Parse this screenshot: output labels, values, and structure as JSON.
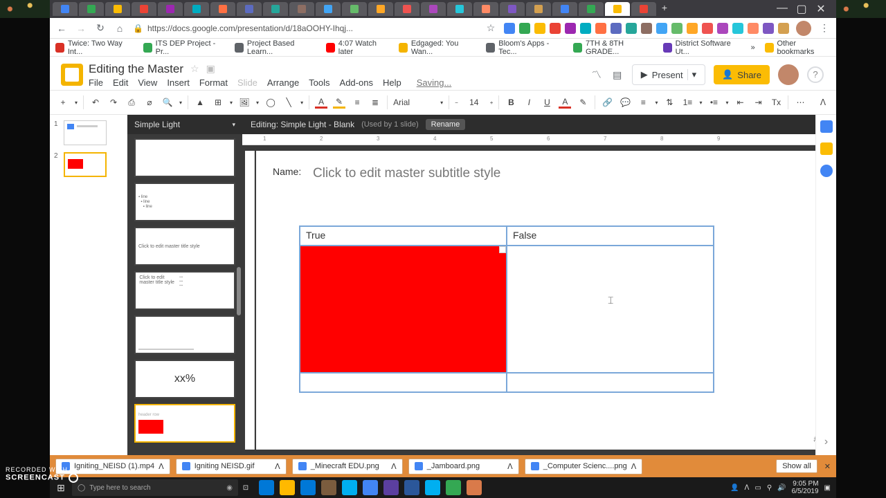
{
  "window": {
    "min": "—",
    "max": "▢",
    "close": "✕",
    "newtab": "+"
  },
  "nav": {
    "back": "←",
    "fwd": "→",
    "reload": "↻",
    "home": "⌂",
    "lock": "🔒",
    "star": "☆",
    "menu": "⋮"
  },
  "url": "https://docs.google.com/presentation/d/18aOOHY-Ihqj...",
  "bookmarks": [
    {
      "label": "Twice: Two Way Int...",
      "c": "#d93025"
    },
    {
      "label": "ITS DEP Project - Pr...",
      "c": "#34a853"
    },
    {
      "label": "Project Based Learn...",
      "c": "#5f6368"
    },
    {
      "label": "4:07 Watch later",
      "c": "#ff0000"
    },
    {
      "label": "Edgaged: You Wan...",
      "c": "#f4b400"
    },
    {
      "label": "Bloom's Apps - Tec...",
      "c": "#5f6368"
    },
    {
      "label": "7TH & 8TH GRADE...",
      "c": "#34a853"
    },
    {
      "label": "District Software Ut...",
      "c": "#673ab7"
    }
  ],
  "bm_overflow": "»",
  "bm_other": "Other bookmarks",
  "doc": {
    "title": "Editing the Master",
    "star": "☆",
    "folder": "▣",
    "menus": [
      "File",
      "Edit",
      "View",
      "Insert",
      "Format",
      "Slide",
      "Arrange",
      "Tools",
      "Add-ons",
      "Help"
    ],
    "saving": "Saving...",
    "trend": "〽",
    "comment": "▤",
    "present": "Present",
    "present_icon": "▶",
    "share": "Share",
    "share_icon": "👤",
    "help": "?"
  },
  "toolbar": {
    "new": "+",
    "undo": "↶",
    "redo": "↷",
    "print": "⎙",
    "paint": "⌀",
    "zoom": "🔍",
    "select": "▲",
    "textbox": "⊞",
    "image": "🖼",
    "shape": "◯",
    "line": "╲",
    "fillcolor": "#d93025",
    "bordercolor": "#f4b400",
    "borderw": "≡",
    "borderdash": "≣",
    "font": "Arial",
    "size": "14",
    "bold": "B",
    "italic": "I",
    "underline": "U",
    "textcolor": "A",
    "highlight": "✎",
    "link": "🔗",
    "comment": "💬",
    "align": "≡",
    "linesp": "⇅",
    "numlist": "1≡",
    "bullist": "•≡",
    "out": "⇤",
    "in": "⇥",
    "clear": "Tx",
    "more": "⋯",
    "collapse": "ᐱ"
  },
  "filmstrip": [
    {
      "n": "1"
    },
    {
      "n": "2"
    }
  ],
  "theme": {
    "name": "Simple Light",
    "editing": "Editing: Simple Light - Blank",
    "used": "(Used by 1 slide)",
    "rename": "Rename",
    "close": "✕",
    "layouts": {
      "title": "Click to edit master title style",
      "titlebody": "Click to edit master title style",
      "percent": "xx%"
    }
  },
  "ruler": [
    "1",
    "2",
    "3",
    "4",
    "5",
    "6",
    "7",
    "8",
    "9"
  ],
  "slide": {
    "name_label": "Name:",
    "subtitle": "Click to edit master subtitle style",
    "true": "True",
    "false": "False",
    "pagenum": "#"
  },
  "downloads": [
    "Igniting_NEISD (1).mp4",
    "Igniting NEISD.gif",
    "_Minecraft EDU.png",
    "_Jamboard.png",
    "_Computer Scienc....png"
  ],
  "dl": {
    "showall": "Show all",
    "close": "✕"
  },
  "taskbar": {
    "win": "⊞",
    "search_placeholder": "Type here to search",
    "mic": "◉",
    "time": "9:05 PM",
    "date": "6/5/2019"
  },
  "watermark": {
    "top": "RECORDED WITH",
    "bottom": "SCREENCAST"
  },
  "rail_colors": [
    "#f4b400",
    "#fbbc04",
    "#4285f4"
  ],
  "tab_count": 23,
  "active_tab_index": 21,
  "ext_colors": [
    "#4285f4",
    "#34a853",
    "#fbbc04",
    "#ea4335",
    "#9c27b0",
    "#00acc1",
    "#ff7043",
    "#5c6bc0",
    "#26a69a",
    "#8d6e63",
    "#42a5f5",
    "#66bb6a",
    "#ffa726",
    "#ef5350",
    "#ab47bc",
    "#26c6da",
    "#ff8a65",
    "#7e57c2",
    "#d4a050"
  ],
  "app_colors": [
    "#0078d7",
    "#ffb900",
    "#0078d7",
    "#7b5c3e",
    "#00aff0",
    "#4285f4",
    "#5b3fa0",
    "#2b579a",
    "#00aff0",
    "#34a853",
    "#d97a4a"
  ]
}
